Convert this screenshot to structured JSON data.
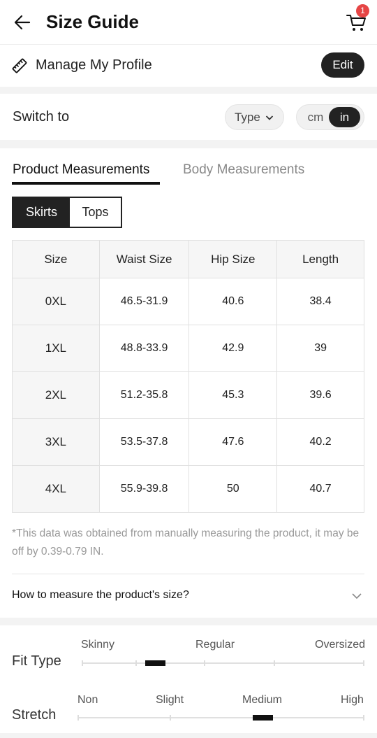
{
  "header": {
    "title": "Size Guide",
    "back_icon": "arrow-left-icon",
    "cart_icon": "cart-icon",
    "cart_count": "1",
    "badge_color": "#e64545"
  },
  "profile": {
    "icon": "ruler-icon",
    "label": "Manage My Profile",
    "edit_label": "Edit"
  },
  "switch": {
    "label": "Switch to",
    "type_label": "Type",
    "unit_cm": "cm",
    "unit_in": "in",
    "selected_unit": "in"
  },
  "tabs": {
    "product": "Product Measurements",
    "body": "Body Measurements",
    "active": "product"
  },
  "category": {
    "skirts": "Skirts",
    "tops": "Tops",
    "active": "skirts"
  },
  "table": {
    "headers": [
      "Size",
      "Waist Size",
      "Hip Size",
      "Length"
    ],
    "rows": [
      [
        "0XL",
        "46.5-31.9",
        "40.6",
        "38.4"
      ],
      [
        "1XL",
        "48.8-33.9",
        "42.9",
        "39"
      ],
      [
        "2XL",
        "51.2-35.8",
        "45.3",
        "39.6"
      ],
      [
        "3XL",
        "53.5-37.8",
        "47.6",
        "40.2"
      ],
      [
        "4XL",
        "55.9-39.8",
        "50",
        "40.7"
      ]
    ]
  },
  "note": "*This data was obtained from manually measuring the product, it may be off by 0.39-0.79 IN.",
  "howto": {
    "label": "How to measure the product's size?",
    "icon": "chevron-down-icon"
  },
  "fit_type": {
    "title": "Fit Type",
    "labels": [
      "Skinny",
      "Regular",
      "Oversized"
    ],
    "selected": "Skinny-Regular"
  },
  "stretch": {
    "title": "Stretch",
    "labels": [
      "Non",
      "Slight",
      "Medium",
      "High"
    ],
    "selected": "Medium-High"
  }
}
